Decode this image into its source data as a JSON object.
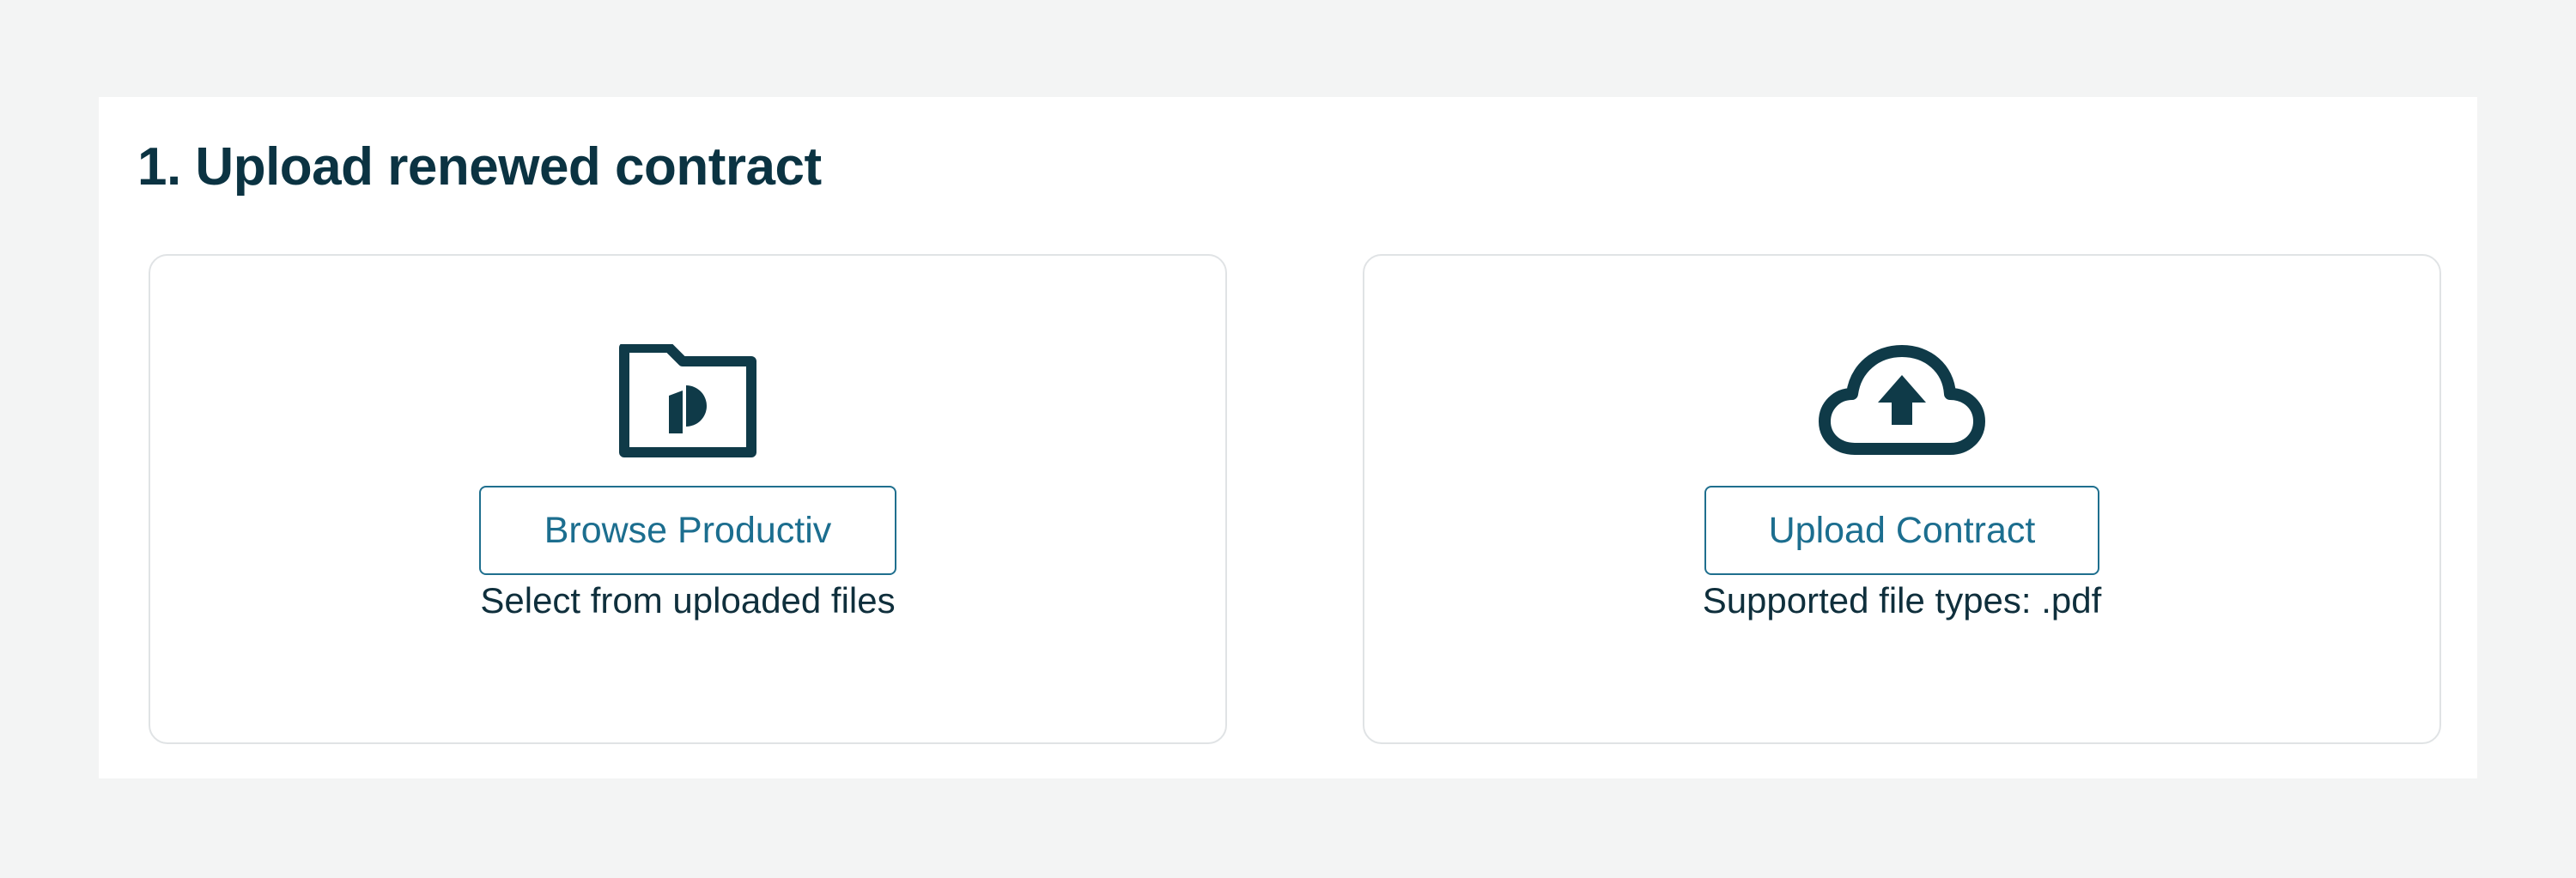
{
  "section": {
    "title": "1. Upload renewed contract"
  },
  "options": {
    "browse": {
      "icon": "productiv-folder-icon",
      "button_label": "Browse Productiv",
      "caption": "Select from uploaded files"
    },
    "upload": {
      "icon": "cloud-upload-icon",
      "button_label": "Upload Contract",
      "caption": "Supported file types: .pdf"
    }
  },
  "colors": {
    "page_background": "#f3f4f4",
    "title_text": "#0b3342",
    "icon": "#0f3a48",
    "button_border": "#1f6f8e",
    "button_text": "#1c6e8f",
    "card_border": "#e0e3e5"
  }
}
